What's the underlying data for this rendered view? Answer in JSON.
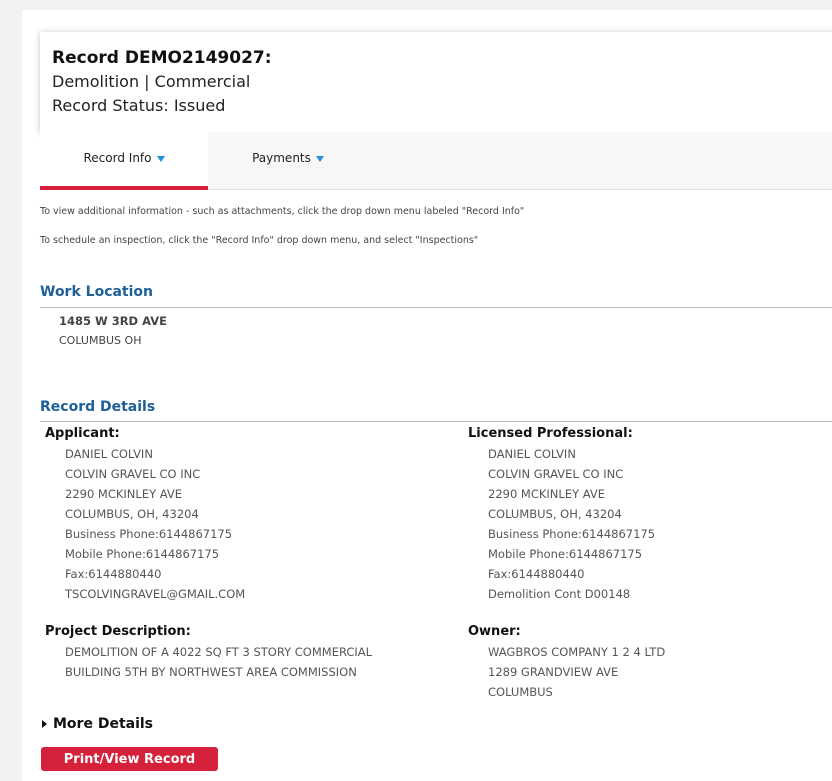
{
  "record": {
    "title": "Record DEMO2149027:",
    "subtitle": "Demolition | Commercial",
    "status": "Record Status: Issued"
  },
  "tabs": [
    {
      "label": "Record Info",
      "active": true
    },
    {
      "label": "Payments",
      "active": false
    }
  ],
  "info_lines": [
    "To view additional information - such as attachments, click the drop down menu labeled \"Record Info\"",
    "To schedule an inspection, click the \"Record Info\" drop down menu, and select \"Inspections\""
  ],
  "work_location": {
    "title": "Work Location",
    "address_line1": "1485 W 3RD AVE",
    "address_line2": "COLUMBUS OH"
  },
  "record_details": {
    "title": "Record Details",
    "applicant": {
      "heading": "Applicant:",
      "lines": [
        "DANIEL COLVIN",
        "COLVIN GRAVEL CO INC",
        "2290 MCKINLEY AVE",
        "COLUMBUS, OH, 43204",
        "Business Phone:6144867175",
        "Mobile Phone:6144867175",
        "Fax:6144880440",
        "TSCOLVINGRAVEL@GMAIL.COM"
      ]
    },
    "licensed_professional": {
      "heading": "Licensed Professional:",
      "lines": [
        "DANIEL COLVIN",
        "COLVIN GRAVEL CO INC",
        "2290 MCKINLEY AVE",
        "COLUMBUS, OH, 43204",
        "Business Phone:6144867175",
        "Mobile Phone:6144867175",
        "Fax:6144880440",
        "Demolition Cont D00148"
      ]
    },
    "project_description": {
      "heading": "Project Description:",
      "lines": [
        "DEMOLITION OF A 4022 SQ FT 3 STORY COMMERCIAL",
        "BUILDING 5TH BY NORTHWEST AREA COMMISSION"
      ]
    },
    "owner": {
      "heading": "Owner:",
      "lines": [
        "WAGBROS COMPANY 1 2 4 LTD",
        "1289 GRANDVIEW AVE",
        "COLUMBUS"
      ]
    }
  },
  "more_details_label": "More Details",
  "print_button_label": "Print/View Record",
  "colors": {
    "accent_red": "#d6213a",
    "section_blue": "#1d5f99",
    "caret_blue": "#1e8fd6"
  }
}
